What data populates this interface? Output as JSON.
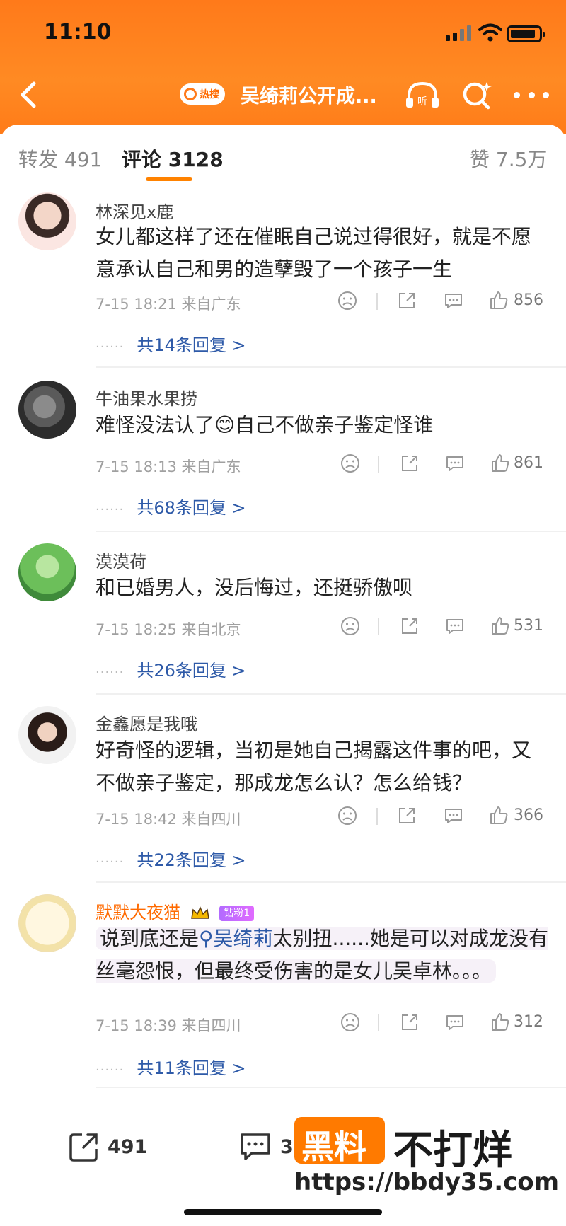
{
  "status": {
    "time": "11:10"
  },
  "nav": {
    "hot_label": "热搜",
    "title": "吴绮莉公开成..."
  },
  "tabs": {
    "repost": "转发 491",
    "comments": "评论 3128",
    "likes": "赞 7.5万"
  },
  "comments": [
    {
      "user": "林深见x鹿",
      "text": "女儿都这样了还在催眠自己说过得很好，就是不愿意承认自己和男的造孽毁了一个孩子一生",
      "time": "7-15 18:21",
      "location": "来自广东",
      "likes": "856",
      "replies": "共14条回复 >"
    },
    {
      "user": "牛油果水果捞",
      "text_before": "难怪没法认了",
      "emoji": "😊",
      "text_after": "自己不做亲子鉴定怪谁",
      "time": "7-15 18:13",
      "location": "来自广东",
      "likes": "861",
      "replies": "共68条回复 >"
    },
    {
      "user": "漠漠荷",
      "text": "和已婚男人，没后悔过，还挺骄傲呗",
      "time": "7-15 18:25",
      "location": "来自北京",
      "likes": "531",
      "replies": "共26条回复 >"
    },
    {
      "user": "金鑫愿是我哦",
      "text": "好奇怪的逻辑，当初是她自己揭露这件事的吧，又不做亲子鉴定，那成龙怎么认？怎么给钱？",
      "time": "7-15 18:42",
      "location": "来自四川",
      "likes": "366",
      "replies": "共22条回复 >"
    },
    {
      "user": "默默大夜猫",
      "fan_badge": "钻粉1",
      "text_before": "说到底还是",
      "mention": "吴绮莉",
      "text_after": "太别扭......她是可以对成龙没有丝毫怨恨，但最终受伤害的是女儿吴卓林。。。",
      "time": "7-15 18:39",
      "location": "来自四川",
      "likes": "312",
      "replies": "共11条回复 >"
    }
  ],
  "replies_dots": "······",
  "bottom_bar": {
    "repost_count": "491",
    "comment_count": "3128"
  },
  "watermark": {
    "box": "黑料",
    "brand": "不打烊",
    "url": "https://bbdy35.com"
  },
  "icons": [
    "back-icon",
    "search-icon",
    "headphones-icon",
    "more-icon",
    "dislike-icon",
    "share-icon",
    "comment-icon",
    "thumbs-up-icon"
  ],
  "colors": {
    "header": "#ff7a1a",
    "accent": "#ff8200",
    "link": "#2e5aa8"
  }
}
